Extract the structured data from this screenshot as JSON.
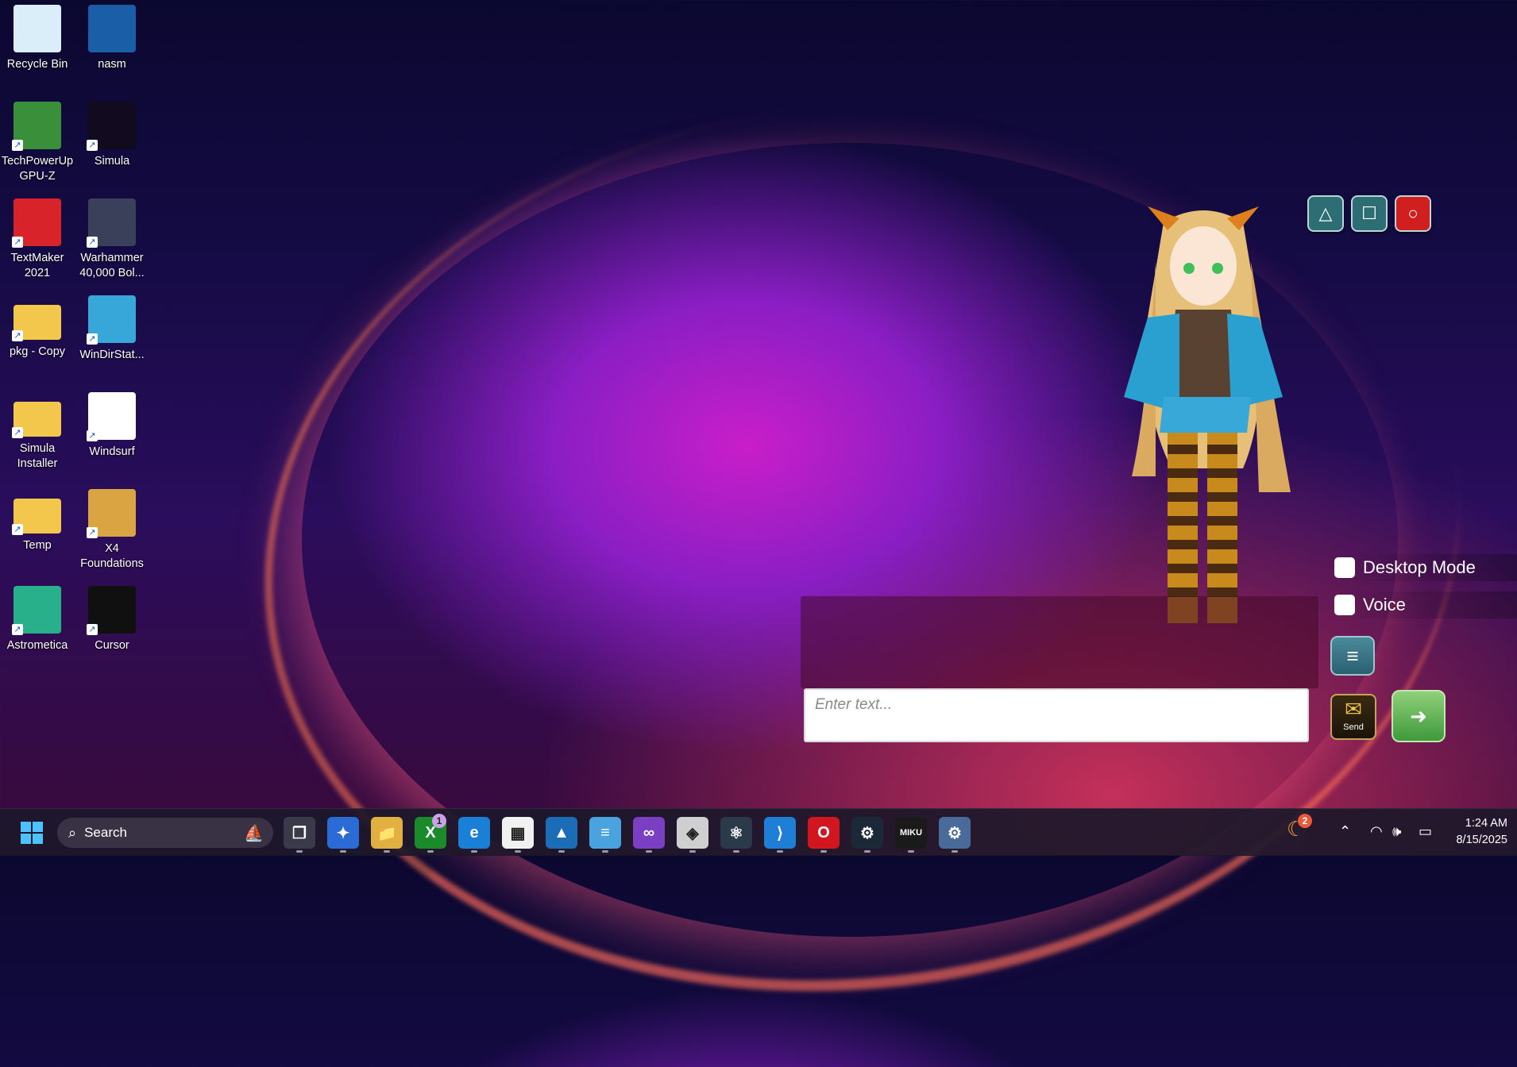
{
  "desktop": {
    "icons": [
      {
        "label": "Recycle Bin",
        "icon": "recycle-bin-icon",
        "color": "#d9eef8"
      },
      {
        "label": "nasm",
        "icon": "nasm-icon",
        "color": "#1b5ea8"
      },
      {
        "label": "TechPowerUp GPU-Z",
        "icon": "gpuz-icon",
        "color": "#3a8f3a"
      },
      {
        "label": "Simula",
        "icon": "simula-icon",
        "color": "#120a1e"
      },
      {
        "label": "TextMaker 2021",
        "icon": "textmaker-icon",
        "color": "#d8232a"
      },
      {
        "label": "Warhammer 40,000 Bol...",
        "icon": "warhammer-icon",
        "color": "#3a3f5a"
      },
      {
        "label": "pkg - Copy",
        "icon": "folder-icon",
        "color": "#f3c64c"
      },
      {
        "label": "WinDirStat...",
        "icon": "windirstat-icon",
        "color": "#37a6d8"
      },
      {
        "label": "Simula Installer",
        "icon": "folder-icon",
        "color": "#f3c64c"
      },
      {
        "label": "Windsurf",
        "icon": "windsurf-icon",
        "color": "#ffffff"
      },
      {
        "label": "Temp",
        "icon": "folder-icon",
        "color": "#f3c64c"
      },
      {
        "label": "X4 Foundations",
        "icon": "x4-icon",
        "color": "#d9a441"
      },
      {
        "label": "Astrometica",
        "icon": "astrometica-icon",
        "color": "#27b08a"
      },
      {
        "label": "Cursor",
        "icon": "cursor-icon",
        "color": "#101010"
      }
    ]
  },
  "assistant": {
    "window_buttons": [
      {
        "name": "minimize-button",
        "glyph": "△",
        "color": "#2d6e74"
      },
      {
        "name": "maximize-button",
        "glyph": "☐",
        "color": "#2d6e74"
      },
      {
        "name": "close-button",
        "glyph": "○",
        "color": "#d11f1f"
      }
    ],
    "desktop_mode_label": "Desktop Mode",
    "voice_label": "Voice",
    "input_placeholder": "Enter text...",
    "send_label": "Send"
  },
  "taskbar": {
    "search_placeholder": "Search",
    "xbox_badge": "1",
    "tray_badge": "2",
    "time": "1:24 AM",
    "date": "8/15/2025",
    "apps": [
      {
        "name": "task-view-icon",
        "glyph": "❐",
        "bg": "#3a3a4a"
      },
      {
        "name": "copilot-icon",
        "glyph": "✦",
        "bg": "#2b6bd6"
      },
      {
        "name": "file-explorer-icon",
        "glyph": "📁",
        "bg": "#e0b040"
      },
      {
        "name": "xbox-icon",
        "glyph": "X",
        "bg": "#1a8a2a"
      },
      {
        "name": "edge-icon",
        "glyph": "e",
        "bg": "#1a7fd6"
      },
      {
        "name": "microsoft-store-icon",
        "glyph": "▦",
        "bg": "#f1f1f1"
      },
      {
        "name": "photos-icon",
        "glyph": "▲",
        "bg": "#1c6db8"
      },
      {
        "name": "notepad-icon",
        "glyph": "≡",
        "bg": "#4aa3df"
      },
      {
        "name": "visual-studio-icon",
        "glyph": "∞",
        "bg": "#7b3fc4"
      },
      {
        "name": "unity-icon",
        "glyph": "◈",
        "bg": "#cfcfcf"
      },
      {
        "name": "electron-icon",
        "glyph": "⚛",
        "bg": "#2b3a4a"
      },
      {
        "name": "vscode-icon",
        "glyph": "⟩",
        "bg": "#1f7fd6"
      },
      {
        "name": "opera-icon",
        "glyph": "O",
        "bg": "#d1161f"
      },
      {
        "name": "steam-icon",
        "glyph": "⚙",
        "bg": "#1b2838"
      },
      {
        "name": "miku-app-icon",
        "glyph": "MIKU",
        "bg": "#1a1a1a"
      },
      {
        "name": "settings-icon",
        "glyph": "⚙",
        "bg": "#4a6b9a"
      }
    ]
  }
}
